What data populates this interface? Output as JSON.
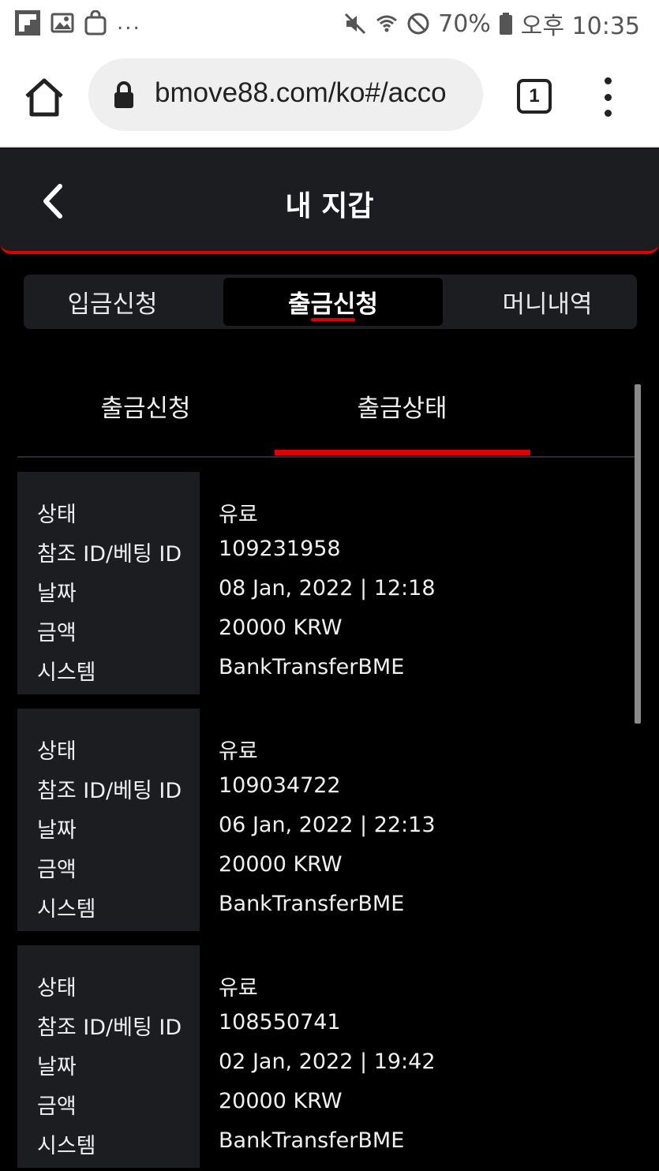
{
  "status_bar": {
    "overflow": "...",
    "battery": "70%",
    "time": "오후 10:35"
  },
  "browser": {
    "url": "bmove88.com/ko#/acco",
    "tab_count": "1"
  },
  "header": {
    "title": "내 지갑"
  },
  "main_tabs": [
    {
      "label": "입금신청",
      "active": false
    },
    {
      "label": "출금신청",
      "active": true
    },
    {
      "label": "머니내역",
      "active": false
    }
  ],
  "sub_tabs": [
    {
      "label": "출금신청",
      "active": false
    },
    {
      "label": "출금상태",
      "active": true
    }
  ],
  "field_labels": {
    "status": "상태",
    "ref_id": "참조 ID/베팅 ID",
    "date": "날짜",
    "amount": "금액",
    "system": "시스템"
  },
  "records": [
    {
      "status": "유료",
      "ref_id": "109231958",
      "date": "08 Jan, 2022 | 12:18",
      "amount": "20000 KRW",
      "system": "BankTransferBME"
    },
    {
      "status": "유료",
      "ref_id": "109034722",
      "date": "06 Jan, 2022 | 22:13",
      "amount": "20000 KRW",
      "system": "BankTransferBME"
    },
    {
      "status": "유료",
      "ref_id": "108550741",
      "date": "02 Jan, 2022 | 19:42",
      "amount": "20000 KRW",
      "system": "BankTransferBME"
    }
  ],
  "colors": {
    "accent": "#e00000",
    "panel": "#1c1d21",
    "background": "#000000"
  }
}
